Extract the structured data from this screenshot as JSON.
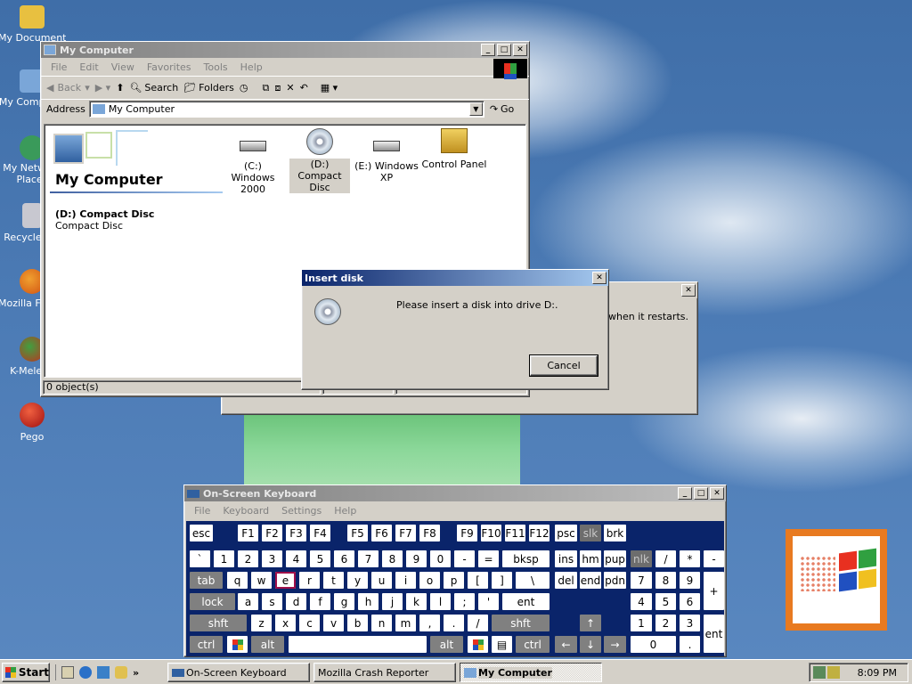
{
  "desktop_icons": [
    {
      "label": "My Documents",
      "icon": "my-documents-icon",
      "color": "#e8c040"
    },
    {
      "label": "My Computer",
      "icon": "my-computer-icon",
      "color": "#7aa6d8"
    },
    {
      "label": "My Network Places",
      "icon": "network-places-icon",
      "color": "#3a9a5a"
    },
    {
      "label": "Recycle Bin",
      "icon": "recycle-bin-icon",
      "color": "#c8c8d0"
    },
    {
      "label": "Mozilla Firefox",
      "icon": "firefox-icon",
      "color": "#e07020"
    },
    {
      "label": "K-Meleon",
      "icon": "k-meleon-icon",
      "color": "#c03020"
    },
    {
      "label": "Pego",
      "icon": "pego-icon",
      "color": "#c02010"
    }
  ],
  "explorer": {
    "title": "My Computer",
    "menu": [
      "File",
      "Edit",
      "View",
      "Favorites",
      "Tools",
      "Help"
    ],
    "toolbar": {
      "back": "Back",
      "search": "Search",
      "folders": "Folders"
    },
    "address_label": "Address",
    "address_value": "My Computer",
    "go": "Go",
    "header": "My Computer",
    "selected_name": "(D:) Compact Disc",
    "selected_type": "Compact Disc",
    "items": [
      {
        "line1": "(C:) Windows",
        "line2": "2000",
        "icon": "hard-drive-icon"
      },
      {
        "line1": "(D:) Compact",
        "line2": "Disc",
        "icon": "compact-disc-icon"
      },
      {
        "line1": "(E:) Windows",
        "line2": "XP",
        "icon": "hard-drive-icon"
      },
      {
        "line1": "Control Panel",
        "line2": "",
        "icon": "control-panel-icon"
      }
    ],
    "status": "0 object(s)"
  },
  "crash_dialog": {
    "text": "s when it restarts."
  },
  "insert_dialog": {
    "title": "Insert disk",
    "message": "Please insert a disk into drive D:.",
    "cancel": "Cancel"
  },
  "osk": {
    "title": "On-Screen Keyboard",
    "menu": [
      "File",
      "Keyboard",
      "Settings",
      "Help"
    ]
  },
  "taskbar": {
    "start": "Start",
    "tasks": [
      "On-Screen Keyboard",
      "Mozilla Crash Reporter",
      "My Computer"
    ],
    "clock": "8:09 PM"
  }
}
